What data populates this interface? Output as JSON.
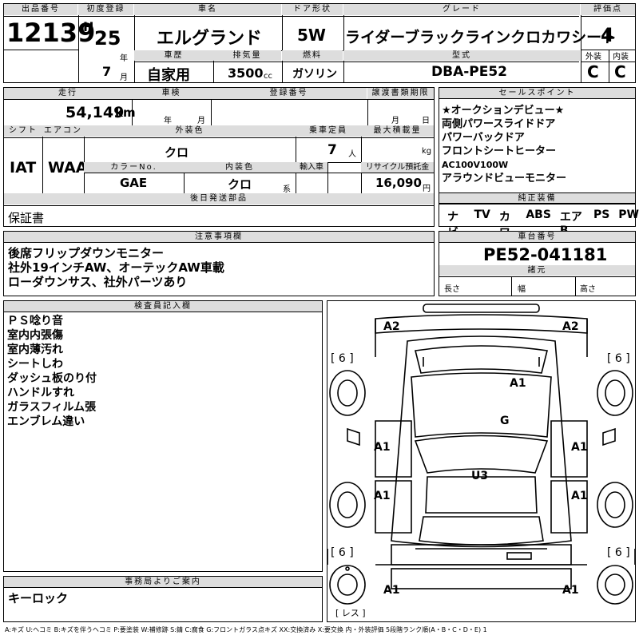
{
  "header": {
    "lot_label": "出品番号",
    "lot_no": "12139",
    "reg_label": "初度登録",
    "era": "H",
    "year": "25",
    "year_unit": "年",
    "month": "7",
    "month_unit": "月",
    "name_label": "車名",
    "car_name": "エルグランド",
    "door_label": "ドア形状",
    "door": "5W",
    "grade_label": "グレード",
    "grade": "ライダーブラックラインクロカワシート",
    "score_label": "評価点",
    "score": "4",
    "history_label": "車歴",
    "history": "自家用",
    "disp_label": "排気量",
    "displacement": "3500",
    "disp_unit": "cc",
    "fuel_label": "燃料",
    "fuel": "ガソリン",
    "model_label": "型式",
    "model": "DBA-PE52",
    "ext_label": "外装",
    "ext_grade": "C",
    "int_label": "内装",
    "int_grade": "C"
  },
  "row2": {
    "mileage_label": "走行",
    "mileage": "54,149",
    "mileage_unit": "km",
    "inspect_label": "車検",
    "year_unit": "年",
    "month_unit": "月",
    "plate_label": "登録番号",
    "transfer_label": "譲渡書類期限",
    "t_month": "月",
    "t_day": "日",
    "shift_label": "シフト",
    "shift": "IAT",
    "ac_label": "エアコン",
    "ac": "WAA",
    "ext_color_label": "外装色",
    "ext_color": "クロ",
    "seats_label": "乗車定員",
    "seats": "7",
    "seats_unit": "人",
    "load_label": "最大積載量",
    "load_unit": "kg",
    "color_no_label": "カラーNo.",
    "color_no": "GAE",
    "int_color_label": "内装色",
    "int_color": "クロ",
    "int_color_unit": "系",
    "import_label": "輸入車",
    "recycle_label": "リサイクル預託金",
    "recycle": "16,090",
    "recycle_unit": "円",
    "later_label": "後日発送部品",
    "later_item": "保証書"
  },
  "sales_points": {
    "label": "セールスポイント",
    "items": [
      "★オークションデビュー★",
      "両側パワースライドドア",
      "パワーバックドア",
      "フロントシートヒーター",
      "AC100V100W",
      "アラウンドビューモニター"
    ]
  },
  "equipment": {
    "label": "純正装備",
    "items": [
      "ナビ",
      "TV",
      "カワ",
      "ABS",
      "エアB",
      "PS",
      "PW"
    ]
  },
  "notes": {
    "label": "注意事項欄",
    "items": [
      "後席フリップダウンモニター",
      "社外19インチAW、オーテックAW車載",
      "ローダウンサス、社外パーツあり"
    ]
  },
  "chassis": {
    "label": "車台番号",
    "number": "PE52-041181",
    "spec_label": "諸元",
    "length": "長さ",
    "width": "幅",
    "height": "高さ"
  },
  "inspector": {
    "label": "検査員記入欄",
    "items": [
      "ＰＳ唸り音",
      "室内内張傷",
      "室内薄汚れ",
      "シートしわ",
      "ダッシュ板のり付",
      "ハンドルすれ",
      "ガラスフィルム張",
      "エンブレム違い"
    ]
  },
  "office": {
    "label": "事務局よりご案内",
    "text": "キーロック"
  },
  "diagram_marks": {
    "front_left": "A2",
    "front_right": "A2",
    "tire_fl": "[ 6 ]",
    "tire_fr": "[ 6 ]",
    "tire_rl": "[ 6 ]",
    "tire_rr": "[ 6 ]",
    "hood": "A1",
    "glass": "G",
    "door_fl": "A1",
    "door_fr": "A1",
    "door_rl": "A1",
    "door_rr": "A1",
    "roof": "U3",
    "rear_left": "A1",
    "rear_right": "A1",
    "spare": "[ レス ]"
  },
  "legend": "A:キズ U:ヘコミ B:キズを伴うヘコミ P:要塗装 W:補修跡 S:錆 C:腐食 G:フロントガラス点キズ XX:交換済み X:要交換 内・外装評価 5段階ランク順(A・B・C・D・E) 1"
}
